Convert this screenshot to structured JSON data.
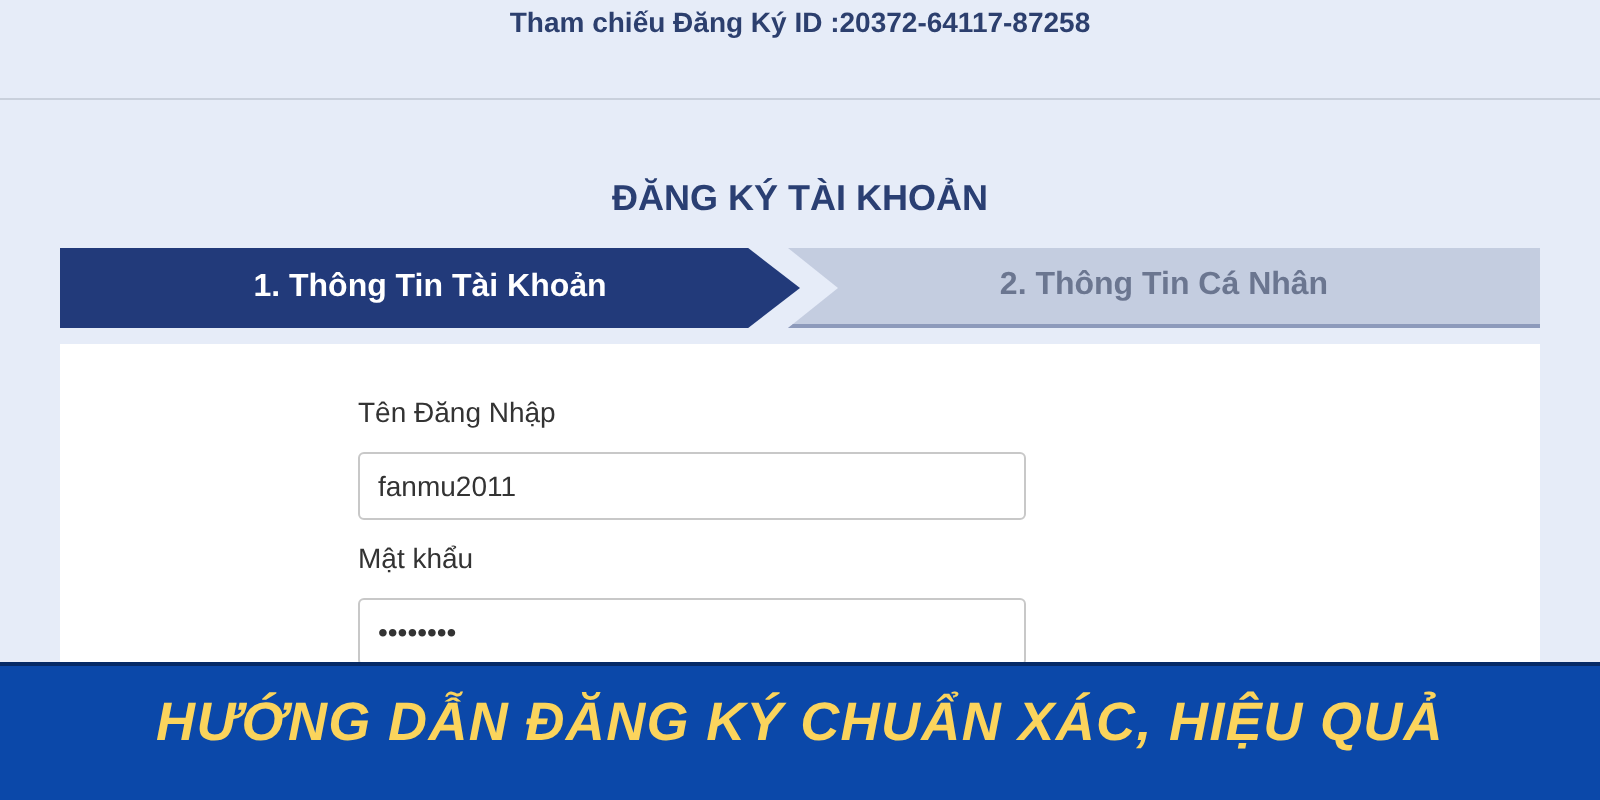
{
  "reference": "Tham chiếu Đăng Ký ID :20372-64117-87258",
  "title": "ĐĂNG KÝ TÀI KHOẢN",
  "steps": [
    {
      "label": "1. Thông Tin Tài Khoản",
      "selected": true
    },
    {
      "label": "2. Thông Tin Cá Nhân",
      "selected": false
    }
  ],
  "fields": [
    {
      "label": "Tên Đăng Nhập",
      "value": "fanmu2011"
    },
    {
      "label": "Mật khẩu",
      "value": "••••••••"
    }
  ],
  "banner": "HƯỚNG DẪN ĐĂNG KÝ CHUẨN XÁC, HIỆU QUẢ"
}
